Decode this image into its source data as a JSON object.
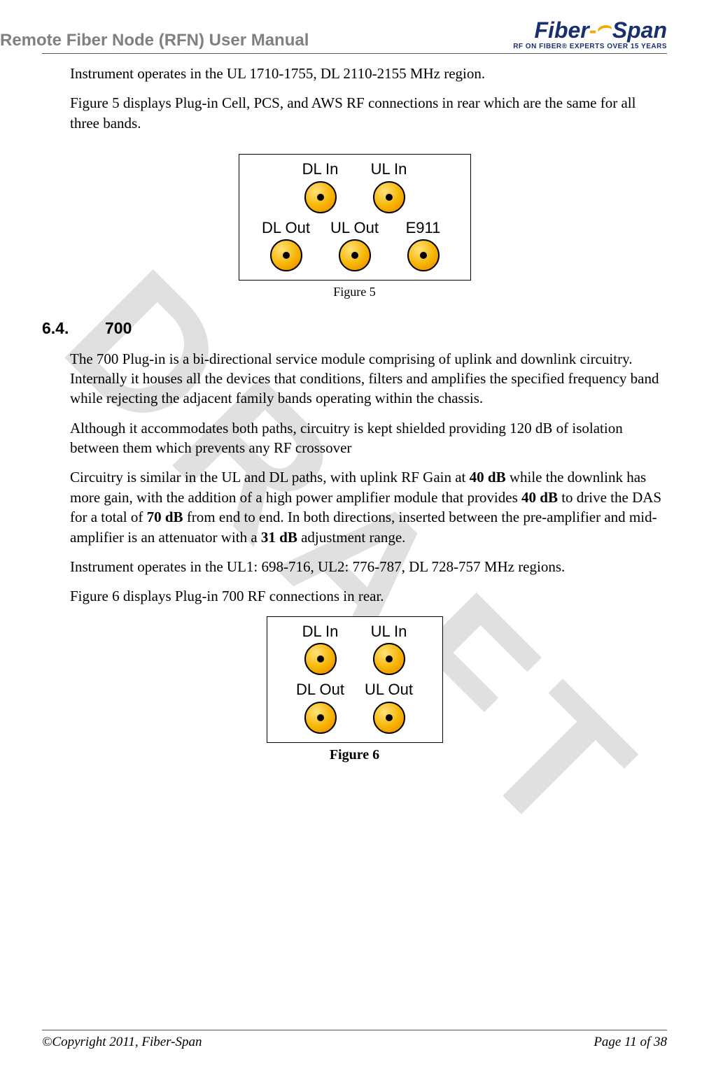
{
  "watermark": "DRAFT",
  "header": {
    "title": "Remote Fiber Node (RFN) User Manual",
    "logo_fiber": "Fiber",
    "logo_dash": "-",
    "logo_span": "Span",
    "logo_tag": "RF ON FIBER® EXPERTS OVER 15 YEARS"
  },
  "body": {
    "p1": "Instrument operates in the UL 1710-1755, DL 2110-2155 MHz region.",
    "p2": "Figure 5 displays Plug-in Cell, PCS, and AWS RF connections in rear which are the same for all three bands.",
    "fig5": {
      "row1": [
        "DL In",
        "UL In"
      ],
      "row2": [
        "DL Out",
        "UL Out",
        "E911"
      ],
      "caption": "Figure 5"
    },
    "section": {
      "num": "6.4.",
      "title": "700"
    },
    "p3": "The 700 Plug-in is a bi-directional service module comprising of uplink and downlink circuitry. Internally it houses all the devices that conditions, filters and amplifies the specified frequency band while rejecting the adjacent family bands operating within the chassis.",
    "p4": "Although it accommodates both paths, circuitry is kept shielded providing 120 dB of isolation between them which prevents any RF crossover",
    "p5_a": "Circuitry is similar in the UL and DL paths, with uplink RF Gain at ",
    "p5_b": "40 dB",
    "p5_c": " while the downlink has more gain, with the addition of a high power amplifier module that provides ",
    "p5_d": "40 dB",
    "p5_e": " to drive the DAS for a total of ",
    "p5_f": "70 dB",
    "p5_g": " from end to end.  In both directions, inserted between the pre-amplifier and mid-amplifier is an attenuator with a ",
    "p5_h": "31 dB",
    "p5_i": " adjustment range.",
    "p6": "Instrument operates in the UL1: 698-716, UL2: 776-787, DL 728-757 MHz regions.",
    "p7": "Figure 6 displays Plug-in 700 RF connections in rear.",
    "fig6": {
      "row1": [
        "DL In",
        "UL In"
      ],
      "row2": [
        "DL Out",
        "UL Out"
      ],
      "caption": "Figure 6"
    }
  },
  "footer": {
    "left": "©Copyright 2011, Fiber-Span",
    "right": "Page 11 of 38"
  }
}
